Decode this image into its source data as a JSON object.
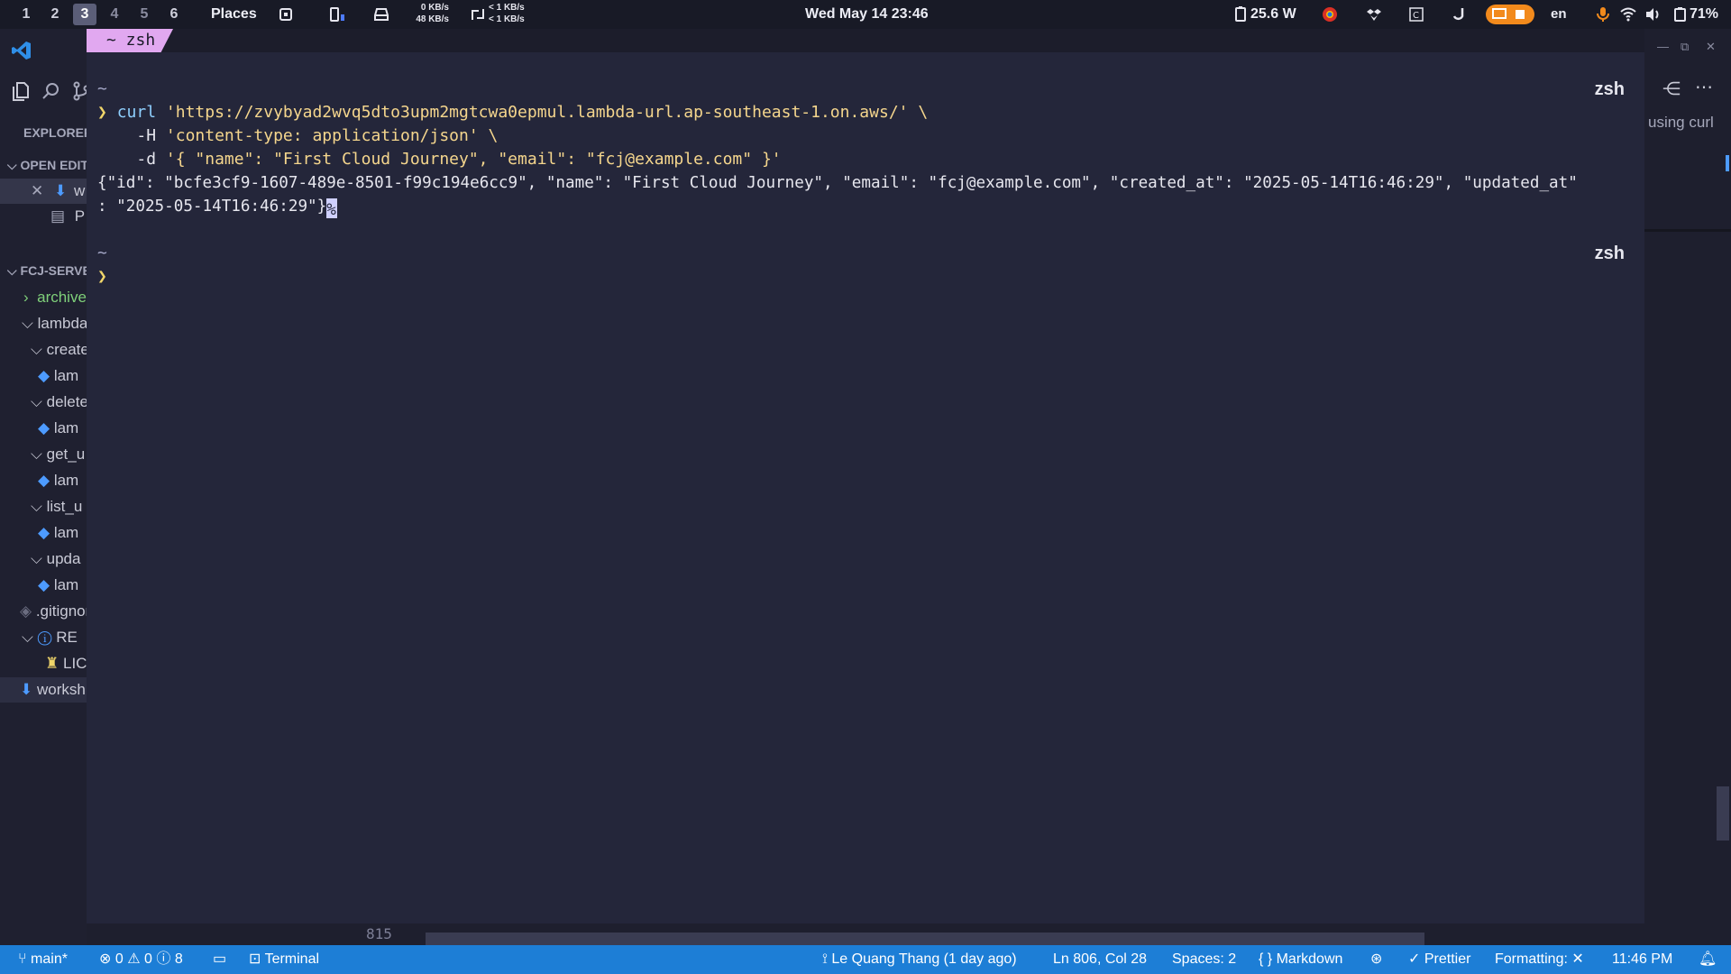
{
  "topbar": {
    "workspaces": [
      "1",
      "2",
      "3",
      "4",
      "5",
      "6"
    ],
    "active_workspace": "3",
    "places": "Places",
    "net_down": "0 KB/s",
    "net_up": "48 KB/s",
    "transfer_down": "< 1 KB/s",
    "transfer_up": "< 1 KB/s",
    "clock": "Wed May 14 23:46",
    "power": "25.6 W",
    "language": "en",
    "battery": "71%",
    "icons": [
      "cpu-icon",
      "memory-icon",
      "drive-icon",
      "transfer-icon",
      "battery-power-icon",
      "chrome-icon",
      "dropbox-icon",
      "ide-icon",
      "hook-icon",
      "screencast-icon",
      "mic-icon",
      "wifi-icon",
      "volume-icon",
      "battery-icon"
    ]
  },
  "explorer": {
    "title": "EXPLORER",
    "open_editors": "OPEN EDITORS",
    "project": "FCJ-SERVERLESS",
    "items": [
      {
        "label": "w",
        "indent": 0
      },
      {
        "label": "P",
        "indent": 0
      },
      {
        "label": "archive",
        "indent": 1
      },
      {
        "label": "lambda",
        "indent": 1
      },
      {
        "label": "create",
        "indent": 2
      },
      {
        "label": "lam",
        "indent": 3
      },
      {
        "label": "delete",
        "indent": 2
      },
      {
        "label": "lam",
        "indent": 3
      },
      {
        "label": "get_u",
        "indent": 2
      },
      {
        "label": "lam",
        "indent": 3
      },
      {
        "label": "list_u",
        "indent": 2
      },
      {
        "label": "lam",
        "indent": 3
      },
      {
        "label": "upda",
        "indent": 2
      },
      {
        "label": "lam",
        "indent": 3
      },
      {
        "label": ".gitignore",
        "indent": 1
      },
      {
        "label": "RE",
        "indent": 1
      },
      {
        "label": "LIC",
        "indent": 2
      },
      {
        "label": "worksh",
        "indent": 1
      }
    ]
  },
  "terminal": {
    "tab_label": "~ zsh",
    "shell_label": "zsh",
    "lines": {
      "tilde": "~",
      "prompt": "❯",
      "cmd_curl": "curl",
      "cmd_url": "'https://zvybyad2wvq5dto3upm2mgtcwa0epmul.lambda-url.ap-southeast-1.on.aws/' \\",
      "header_flag": "-H",
      "header_val": "'content-type: application/json' \\",
      "data_flag": "-d",
      "data_val": "'{ \"name\": \"First Cloud Journey\", \"email\": \"fcj@example.com\" }'",
      "response_1": "{\"id\": \"bcfe3cf9-1607-489e-8501-f99c194e6cc9\", \"name\": \"First Cloud Journey\", \"email\": \"fcj@example.com\", \"created_at\": \"2025-05-14T16:46:29\", \"updated_at\"",
      "response_2": ": \"2025-05-14T16:46:29\"}",
      "cursor_char": "%"
    }
  },
  "right_panel": {
    "text": "using curl"
  },
  "peek": {
    "line_number": "815"
  },
  "statusbar": {
    "branch": "main*",
    "errors": "0",
    "warnings": "0",
    "info": "8",
    "terminal": "Terminal",
    "blame": "Le Quang Thang (1 day ago)",
    "position": "Ln 806, Col 28",
    "spaces": "Spaces: 2",
    "language": "Markdown",
    "prettier": "Prettier",
    "formatting": "Formatting: ✕",
    "time": "11:46 PM"
  },
  "colors": {
    "statusbar": "#1d7ed6",
    "terminal_bg": "#24263a",
    "tab_accent": "#e1a8f0",
    "prompt": "#f1d66a"
  }
}
